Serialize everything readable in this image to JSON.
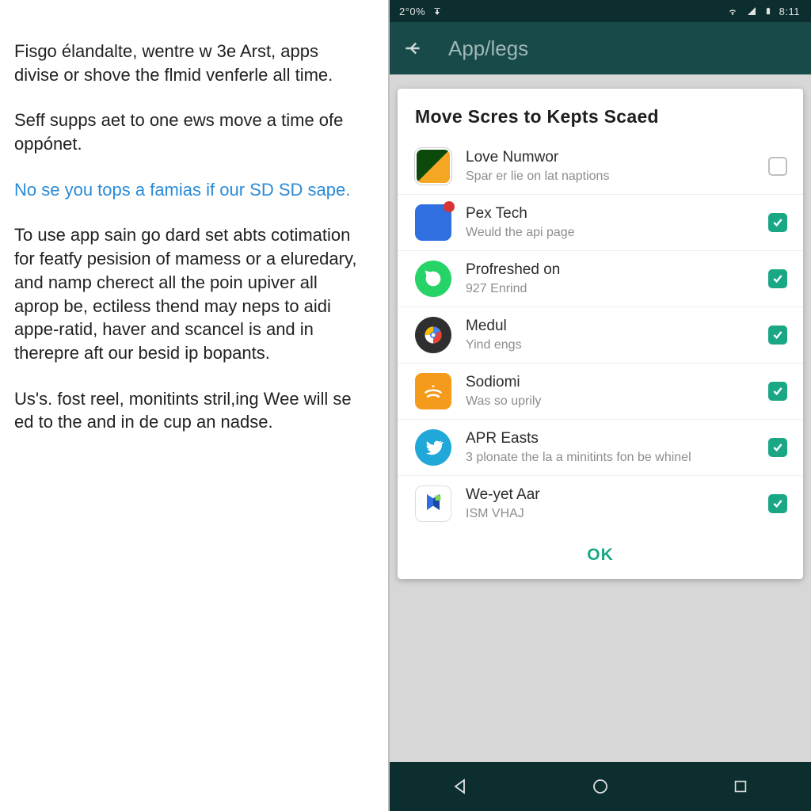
{
  "left": {
    "p1": "Fisgo élandalte, wentre w 3e Arst, apps divise or shove the flmid venferle all time.",
    "p2": "Seff supps aet to one ews move a time ofe oppónet.",
    "link": "No se you tops a famias if our SD SD sape.",
    "p3": "To use app sain go dard set abts cotimation for featfy pesision of mamess or a eluredary, and namp cherect all the poin upiver all aprop be, ectiless thend may neps to aidi appe-ratid, haver and scancel is and in therepre aft our besid ip bopants.",
    "p4": "Us's. fost reel, monitints stril,ing Wee will se ed to the and in de cup an nadse."
  },
  "status": {
    "left": "2°0%",
    "time": "8:11"
  },
  "appbar": {
    "title": "App/legs"
  },
  "dialog": {
    "title": "Move Scres to Kepts Scaed",
    "ok": "OK"
  },
  "apps": [
    {
      "name": "Love Numwor",
      "sub": "Spar er lie on lat naptions",
      "checked": false
    },
    {
      "name": "Pex Tech",
      "sub": "Weuld the api page",
      "checked": true
    },
    {
      "name": "Profreshed on",
      "sub": "927 Enrind",
      "checked": true
    },
    {
      "name": "Medul",
      "sub": "Yind engs",
      "checked": true
    },
    {
      "name": "Sodiomi",
      "sub": "Was so uprily",
      "checked": true
    },
    {
      "name": "APR Easts",
      "sub": "3 plonate the la a minitints fon be whinel",
      "checked": true
    },
    {
      "name": "We-yet Aar",
      "sub": "ISM VHAJ",
      "checked": true
    }
  ]
}
